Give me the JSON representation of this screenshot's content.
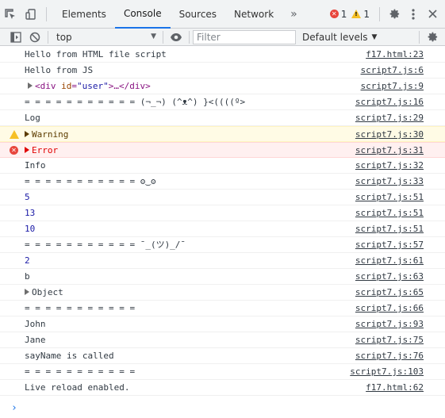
{
  "tabs": [
    {
      "label": "Elements",
      "active": false
    },
    {
      "label": "Console",
      "active": true
    },
    {
      "label": "Sources",
      "active": false
    },
    {
      "label": "Network",
      "active": false
    }
  ],
  "more_tabs_symbol": "»",
  "counts": {
    "errors": "1",
    "warnings": "1"
  },
  "toolbar": {
    "context": "top",
    "filter_placeholder": "Filter",
    "levels_label": "Default levels"
  },
  "colors": {
    "accent": "#1a73e8",
    "error": "#e8453c",
    "warning": "#f6c026"
  },
  "messages": [
    {
      "level": "log",
      "text": "Hello from HTML file script",
      "source": "f17.html:23"
    },
    {
      "level": "log",
      "text": "Hello from JS",
      "source": "script7.js:6"
    },
    {
      "level": "log",
      "kind": "element",
      "tag_open": "<div",
      "attr_name": "id",
      "attr_value": "\"user\"",
      "tag_mid": ">…</div>",
      "source": "script7.js:9"
    },
    {
      "level": "log",
      "text": "= = = = = = = = = = = (¬_¬) (^ᴥ^) }<((((º>",
      "source": "script7.js:16"
    },
    {
      "level": "log",
      "text": "Log",
      "source": "script7.js:29"
    },
    {
      "level": "warning",
      "text": "Warning",
      "source": "script7.js:30",
      "expandable": true
    },
    {
      "level": "error",
      "text": "Error",
      "source": "script7.js:31",
      "expandable": true
    },
    {
      "level": "log",
      "text": "Info",
      "source": "script7.js:32"
    },
    {
      "level": "log",
      "text": "= = = = = = = = = = = ʘ‿ʘ",
      "source": "script7.js:33"
    },
    {
      "level": "log",
      "text": "5",
      "source": "script7.js:51",
      "number": true
    },
    {
      "level": "log",
      "text": "13",
      "source": "script7.js:51",
      "number": true
    },
    {
      "level": "log",
      "text": "10",
      "source": "script7.js:51",
      "number": true
    },
    {
      "level": "log",
      "text": "= = = = = = = = = = = ¯_(ツ)_/¯",
      "source": "script7.js:57"
    },
    {
      "level": "log",
      "text": "2",
      "source": "script7.js:61",
      "number": true
    },
    {
      "level": "log",
      "text": "b",
      "source": "script7.js:63"
    },
    {
      "level": "log",
      "text": "Object",
      "source": "script7.js:65",
      "expandable": true
    },
    {
      "level": "log",
      "text": "= = = = = = = = = = =",
      "source": "script7.js:66"
    },
    {
      "level": "log",
      "text": "John",
      "source": "script7.js:93"
    },
    {
      "level": "log",
      "text": "Jane",
      "source": "script7.js:75"
    },
    {
      "level": "log",
      "text": "sayName is called",
      "source": "script7.js:76"
    },
    {
      "level": "log",
      "text": "= = = = = = = = = = =",
      "source": "script7.js:103"
    },
    {
      "level": "log",
      "text": "Live reload enabled.",
      "source": "f17.html:62"
    }
  ],
  "prompt_symbol": "›"
}
